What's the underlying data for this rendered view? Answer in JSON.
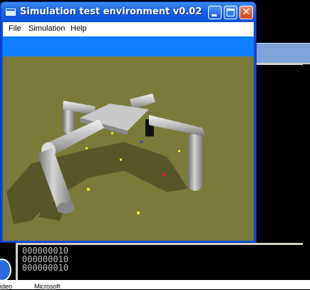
{
  "window": {
    "title": "Simulation test environment v0.02",
    "close_glyph": "✕"
  },
  "menu": {
    "items": [
      "File",
      "Simulation",
      "Help"
    ]
  },
  "console": {
    "lines": [
      "000000010",
      "000000010",
      "000000010"
    ]
  },
  "taskbar": {
    "labels": [
      "ideo",
      "Microsoft"
    ]
  },
  "colors": {
    "ground": "#7a7a3b",
    "toolbar": "#0f7fff",
    "titlebar": "#0a4ede"
  }
}
